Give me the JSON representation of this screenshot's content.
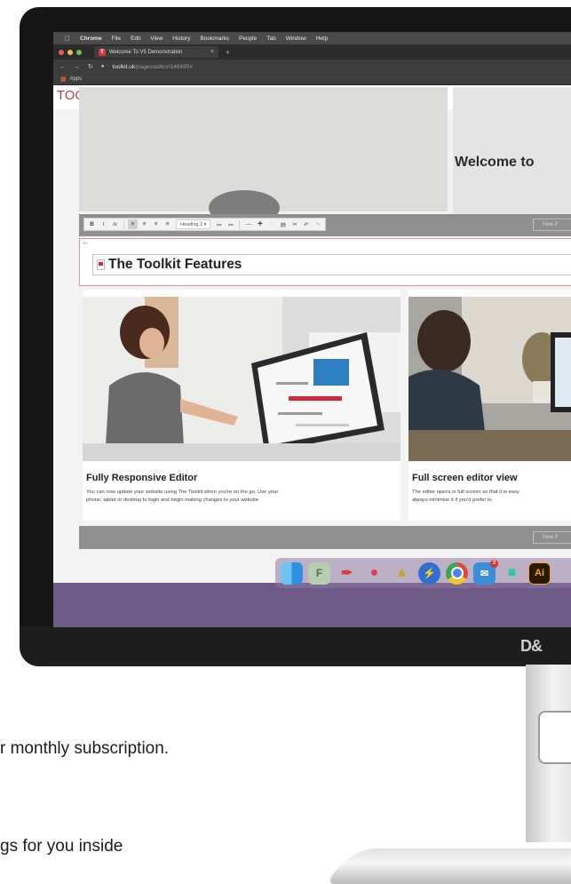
{
  "menubar": {
    "apple": "",
    "items": [
      "Chrome",
      "File",
      "Edit",
      "View",
      "History",
      "Bookmarks",
      "People",
      "Tab",
      "Window",
      "Help"
    ]
  },
  "browser": {
    "tab_title": "Welcome To V5 Demonstration",
    "tab_favicon": "T",
    "tab_close": "×",
    "new_tab": "+",
    "url_domain": "toolkit.uk",
    "url_path": "/pages/editor/146495#",
    "bookmarks_apps": "Apps"
  },
  "site": {
    "logo": "TOOLKIT",
    "welcome_heading": "Welcome to",
    "new_page_label": "New P",
    "div_tag": "div"
  },
  "toolbar": {
    "bold": "B",
    "italic": "I",
    "clear_format": "Ix",
    "heading_select": "Heading 2"
  },
  "editor": {
    "heading": "The Toolkit Features"
  },
  "cards": [
    {
      "title": "Fully Responsive Editor",
      "desc_1": "You can now update your website using The Toolkit when you're on the go. Use your",
      "desc_2": "phone, tablet or desktop to login and begin making changes to your website."
    },
    {
      "title": "Full screen editor view",
      "desc_1": "The editor opens in full screen so that it is easy",
      "desc_2": "always minimise it if you'd prefer to."
    }
  ],
  "dock": {
    "icons": [
      "finder-icon",
      "font-book-icon",
      "pen-tool-icon",
      "speech-bubble-icon",
      "gym-icon",
      "lightning-icon",
      "chrome-icon",
      "mail-icon",
      "slack-icon",
      "illustrator-icon"
    ],
    "mail_badge": "2",
    "illustrator_label": "Ai"
  },
  "monitor": {
    "brand": "D&"
  },
  "promo": {
    "line_1": "r monthly subscription.",
    "line_2": "gs for you inside"
  },
  "colors": {
    "brand_red": "#c9323f",
    "screen_bg": "#6e5a86"
  }
}
